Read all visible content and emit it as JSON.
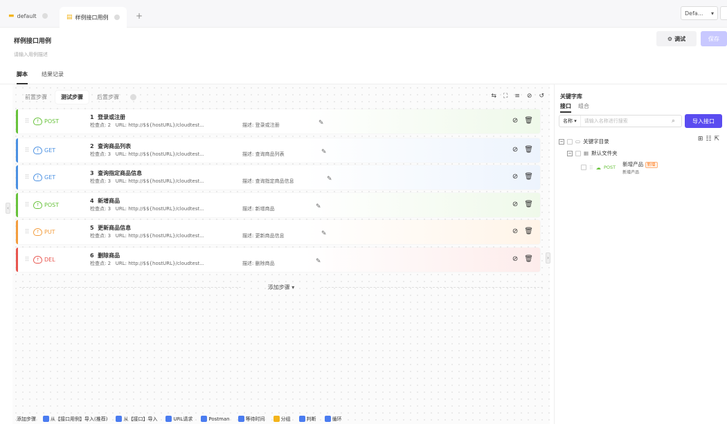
{
  "tabs": [
    {
      "label": "default",
      "icon": "folder-icon"
    },
    {
      "label": "样例接口用例",
      "icon": "case-icon"
    }
  ],
  "tab_add": "+",
  "env": {
    "value": "Defa...",
    "arrow": "▾"
  },
  "header": {
    "title": "样例接口用例",
    "description": "请输入用例描述",
    "debug_label": "调试",
    "save_label": "保存"
  },
  "subtabs": [
    "脚本",
    "结果记录"
  ],
  "step_tabs": [
    "前置步骤",
    "测试步骤",
    "后置步骤"
  ],
  "steps": [
    {
      "num": "1",
      "name": "登录或注册",
      "method": "POST",
      "checks": "检查点: 2",
      "url": "URL: http://$${hostURL}/cloudtest...",
      "desc": "描述: 登录或注册",
      "color": "#67c23a",
      "bg": "#eff9ea"
    },
    {
      "num": "2",
      "name": "查询商品列表",
      "method": "GET",
      "checks": "检查点: 3",
      "url": "URL: http://$${hostURL}/cloudtest...",
      "desc": "描述: 查询商品列表",
      "color": "#4a90e2",
      "bg": "#edf4fd"
    },
    {
      "num": "3",
      "name": "查询指定商品信息",
      "method": "GET",
      "checks": "检查点: 3",
      "url": "URL: http://$${hostURL}/cloudtest...",
      "desc": "描述: 查询指定商品信息",
      "color": "#4a90e2",
      "bg": "#edf4fd"
    },
    {
      "num": "4",
      "name": "新增商品",
      "method": "POST",
      "checks": "检查点: 3",
      "url": "URL: http://$${hostURL}/cloudtest...",
      "desc": "描述: 新增商品",
      "color": "#67c23a",
      "bg": "#eff9ea"
    },
    {
      "num": "5",
      "name": "更新商品信息",
      "method": "PUT",
      "checks": "检查点: 3",
      "url": "URL: http://$${hostURL}/cloudtest...",
      "desc": "描述: 更新商品信息",
      "color": "#f39c3c",
      "bg": "#fff4e8"
    },
    {
      "num": "6",
      "name": "删除商品",
      "method": "DEL",
      "checks": "检查点: 2",
      "url": "URL: http://$${hostURL}/cloudtest...",
      "desc": "描述: 删除商品",
      "color": "#e8554e",
      "bg": "#fdeceb"
    }
  ],
  "add_step": "添加步骤",
  "add_step_arrow": "▾",
  "bottom": {
    "label": "添加步骤",
    "items": [
      {
        "label": "从【接口用例】导入(推荐)",
        "color": "#4a7cf0"
      },
      {
        "label": "从【接口】导入",
        "color": "#4a7cf0"
      },
      {
        "label": "URL请求",
        "color": "#4a7cf0"
      },
      {
        "label": "Postman",
        "color": "#4a7cf0"
      },
      {
        "label": "等待时间",
        "color": "#4a7cf0"
      },
      {
        "label": "分组",
        "color": "#f3b41b"
      },
      {
        "label": "判断",
        "color": "#4a7cf0"
      },
      {
        "label": "循环",
        "color": "#4a7cf0"
      }
    ]
  },
  "keyword": {
    "title": "关键字库",
    "tabs": [
      "接口",
      "组合"
    ],
    "search_select": "名称",
    "search_placeholder": "请输入名称进行搜索",
    "import_label": "导入接口",
    "tree": {
      "root": "关键字目录",
      "folder": "默认文件夹",
      "item_name": "新增产品",
      "item_tag": "新增",
      "item_sub": "新增产品",
      "item_method": "POST"
    }
  }
}
